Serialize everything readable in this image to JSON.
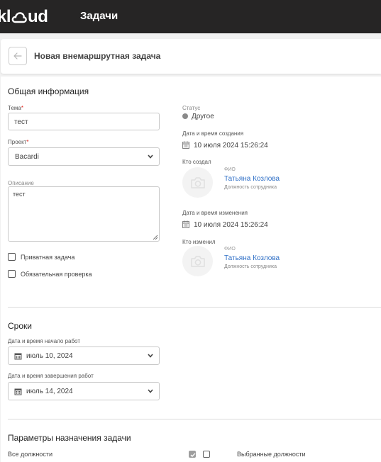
{
  "app": {
    "logo_text": "kloud",
    "title": "Задачи"
  },
  "header": {
    "title": "Новая внемаршрутная задача"
  },
  "general": {
    "section_title": "Общая информация",
    "topic_label": "Тема",
    "topic_value": "тест",
    "project_label": "Проект",
    "project_value": "Bacardi",
    "description_label": "Описание",
    "description_value": "тест",
    "private_task_label": "Приватная задача",
    "mandatory_check_label": "Обязательная проверка",
    "required_mark": "*"
  },
  "info": {
    "status_label": "Статус",
    "status_value": "Другое",
    "status_color": "#8a8a8a",
    "created_label": "Дата и время создания",
    "created_value": "10 июля 2024 15:26:24",
    "created_by_label": "Кто создал",
    "created_by": {
      "fio_label": "ФИО",
      "name": "Татьяна Козлова",
      "position": "Должность сотрудника"
    },
    "modified_label": "Дата и время изменения",
    "modified_value": "10 июля 2024 15:26:24",
    "modified_by_label": "Кто изменил",
    "modified_by": {
      "fio_label": "ФИО",
      "name": "Татьяна Козлова",
      "position": "Должность сотрудника"
    }
  },
  "deadlines": {
    "section_title": "Сроки",
    "start_label": "Дата и время начало работ",
    "start_value": "июль 10, 2024",
    "end_label": "Дата и время завершения работ",
    "end_value": "июль 14, 2024"
  },
  "assignment": {
    "section_title": "Параметры назначения задачи",
    "all_positions_label": "Все должности",
    "selected_positions_label": "Выбранные должности"
  },
  "colors": {
    "topbar": "#262525",
    "link": "#2f6fc6",
    "required": "#e2231a"
  }
}
